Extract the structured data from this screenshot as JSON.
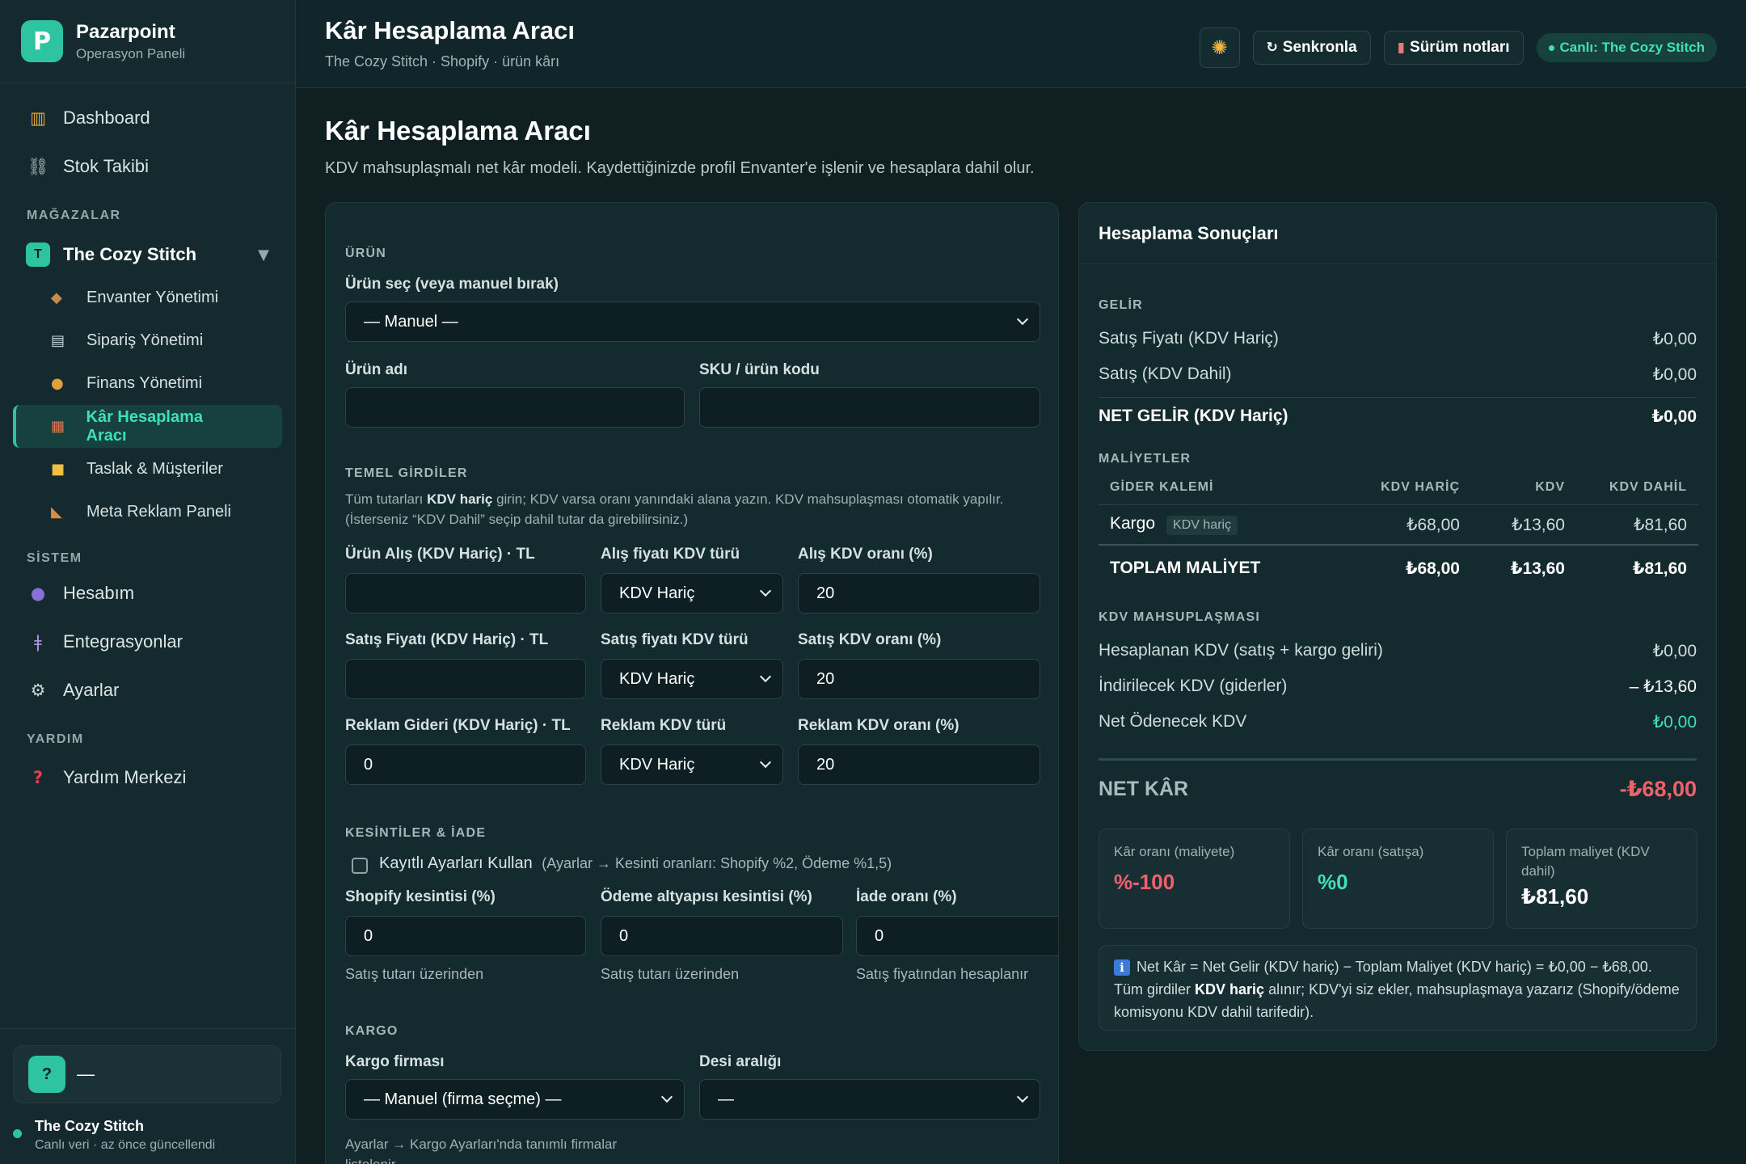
{
  "brand": {
    "name": "Pazarpoint",
    "subtitle": "Operasyon Paneli",
    "logo": "P"
  },
  "nav": {
    "dashboard": "Dashboard",
    "stok": "Stok Takibi"
  },
  "sections": {
    "stores": "MAĞAZALAR",
    "system": "SİSTEM",
    "help": "YARDIM"
  },
  "store": {
    "badge": "T",
    "name": "The Cozy Stitch"
  },
  "store_items": [
    "Envanter Yönetimi",
    "Sipariş Yönetimi",
    "Finans Yönetimi",
    "Kâr Hesaplama Aracı",
    "Taslak & Müşteriler",
    "Meta Reklam Paneli"
  ],
  "system_items": [
    "Hesabım",
    "Entegrasyonlar",
    "Ayarlar"
  ],
  "help_items": [
    "Yardım Merkezi"
  ],
  "footer": {
    "avatar": "?",
    "user": "—",
    "status_title": "The Cozy Stitch",
    "status_sub": "Canlı veri · az önce güncellendi"
  },
  "topbar": {
    "title": "Kâr Hesaplama Aracı",
    "subtitle": "The Cozy Stitch · Shopify · ürün kârı",
    "sync": "Senkronla",
    "notes": "Sürüm notları",
    "live": "Canlı: The Cozy Stitch",
    "sun_icon": "sun-icon"
  },
  "page": {
    "title": "Kâr Hesaplama Aracı",
    "subtitle": "KDV mahsuplaşmalı net kâr modeli. Kaydettiğinizde profil Envanter'e işlenir ve hesaplara dahil olur."
  },
  "form": {
    "urun": {
      "label": "ÜRÜN",
      "select_label": "Ürün seç (veya manuel bırak)",
      "select_value": "— Manuel —",
      "name_label": "Ürün adı",
      "name_value": "",
      "sku_label": "SKU / ürün kodu",
      "sku_value": ""
    },
    "temel": {
      "label": "TEMEL GİRDİLER",
      "note_pre": "Tüm tutarları ",
      "note_bold": "KDV hariç",
      "note_post": " girin; KDV varsa oranı yanındaki alana yazın. KDV mahsuplaşması otomatik yapılır. (İsterseniz “KDV Dahil” seçip dahil tutar da girebilirsiniz.)",
      "rows": [
        {
          "amount_label": "Ürün Alış (KDV Hariç) · TL",
          "amount_value": "",
          "type_label": "Alış fiyatı KDV türü",
          "type_value": "KDV Hariç",
          "rate_label": "Alış KDV oranı (%)",
          "rate_value": "20"
        },
        {
          "amount_label": "Satış Fiyatı (KDV Hariç) · TL",
          "amount_value": "",
          "type_label": "Satış fiyatı KDV türü",
          "type_value": "KDV Hariç",
          "rate_label": "Satış KDV oranı (%)",
          "rate_value": "20"
        },
        {
          "amount_label": "Reklam Gideri (KDV Hariç) · TL",
          "amount_value": "0",
          "type_label": "Reklam KDV türü",
          "type_value": "KDV Hariç",
          "rate_label": "Reklam KDV oranı (%)",
          "rate_value": "20"
        }
      ]
    },
    "kesinti": {
      "label": "KESİNTİLER & İADE",
      "checkbox_label": "Kayıtlı Ayarları Kullan",
      "checkbox_hint": "(Ayarlar → Kesinti oranları: Shopify %2, Ödeme %1,5)",
      "fields": [
        {
          "label": "Shopify kesintisi (%)",
          "value": "0",
          "help": "Satış tutarı üzerinden"
        },
        {
          "label": "Ödeme altyapısı kesintisi (%)",
          "value": "0",
          "help": "Satış tutarı üzerinden"
        },
        {
          "label": "İade oranı (%)",
          "value": "0",
          "help": "Satış fiyatından hesaplanır"
        }
      ]
    },
    "kargo": {
      "label": "KARGO",
      "firma_label": "Kargo firması",
      "firma_value": "— Manuel (firma seçme) —",
      "desi_label": "Desi aralığı",
      "desi_value": "—",
      "note": "Ayarlar → Kargo Ayarları'nda tanımlı firmalar listelenir."
    }
  },
  "results": {
    "title": "Hesaplama Sonuçları",
    "gelir": {
      "label": "GELİR",
      "rows": [
        {
          "label": "Satış Fiyatı (KDV Hariç)",
          "value": "₺0,00"
        },
        {
          "label": "Satış (KDV Dahil)",
          "value": "₺0,00"
        }
      ],
      "net_label": "NET GELİR (KDV Hariç)",
      "net_value": "₺0,00"
    },
    "maliyet": {
      "label": "MALİYETLER",
      "headers": [
        "GİDER KALEMİ",
        "KDV HARİÇ",
        "KDV",
        "KDV DAHİL"
      ],
      "rows": [
        {
          "name": "Kargo",
          "tag": "KDV hariç",
          "ex": "₺68,00",
          "kdv": "₺13,60",
          "inc": "₺81,60"
        }
      ],
      "total": {
        "name": "TOPLAM MALİYET",
        "ex": "₺68,00",
        "kdv": "₺13,60",
        "inc": "₺81,60"
      }
    },
    "kdv": {
      "label": "KDV MAHSUPLAŞMASI",
      "rows": [
        {
          "label": "Hesaplanan KDV (satış + kargo geliri)",
          "value": "₺0,00"
        },
        {
          "label": "İndirilecek KDV (giderler)",
          "value": "– ₺13,60"
        },
        {
          "label": "Net Ödenecek KDV",
          "value": "₺0,00"
        }
      ]
    },
    "net": {
      "label": "NET KÂR",
      "value": "-₺68,00"
    },
    "metrics": [
      {
        "label": "Kâr oranı (maliyete)",
        "value": "%-100"
      },
      {
        "label": "Kâr oranı (satışa)",
        "value": "%0"
      },
      {
        "label": "Toplam maliyet (KDV dahil)",
        "value": "₺81,60"
      }
    ],
    "info": {
      "icon": "ℹ",
      "pre": "Net Kâr = Net Gelir (KDV hariç) − Toplam Maliyet (KDV hariç) = ₺0,00 − ₺68,00. Tüm girdiler ",
      "bold": "KDV hariç",
      "post": " alınır; KDV'yi siz ekler, mahsuplaşmaya yazarız (Shopify/ödeme komisyonu KDV dahil tarifedir)."
    }
  },
  "colors": {
    "accent": "#2ec4a1",
    "negative": "#f0616b",
    "positive": "#3fe0b9",
    "bg": "#0f1f22"
  }
}
